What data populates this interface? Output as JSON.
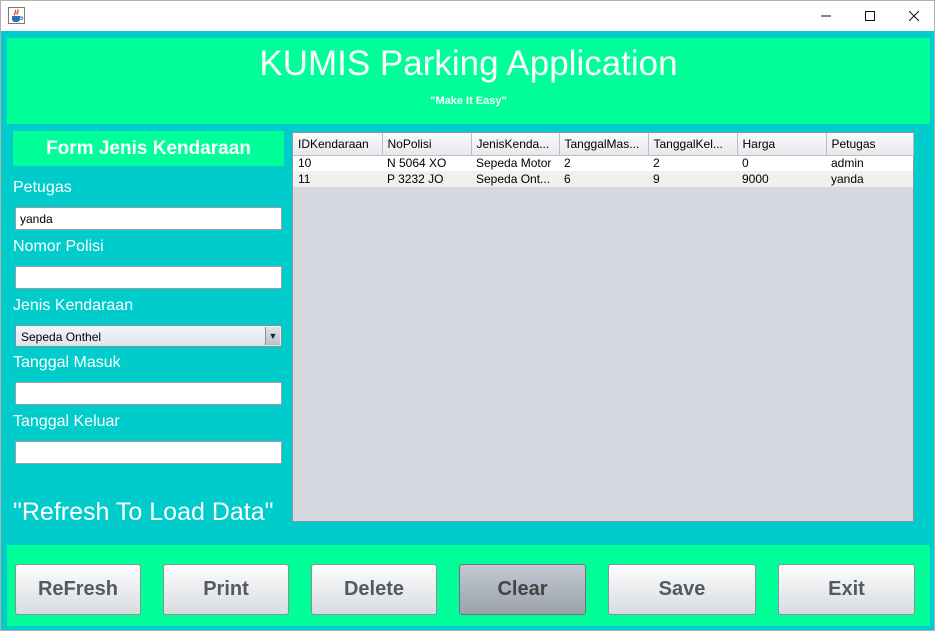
{
  "window": {
    "title": ""
  },
  "header": {
    "title": "KUMIS Parking Application",
    "subtitle": "\"Make It Easy\""
  },
  "form": {
    "title": "Form Jenis Kendaraan",
    "petugas_label": "Petugas",
    "petugas_value": "yanda",
    "nomor_polisi_label": "Nomor Polisi",
    "nomor_polisi_value": "",
    "jenis_kendaraan_label": "Jenis Kendaraan",
    "jenis_kendaraan_value": "Sepeda Onthel",
    "tanggal_masuk_label": "Tanggal Masuk",
    "tanggal_masuk_value": "",
    "tanggal_keluar_label": "Tanggal Keluar",
    "tanggal_keluar_value": "",
    "refresh_note": "\"Refresh To Load Data\""
  },
  "table": {
    "columns": [
      "IDKendaraan",
      "NoPolisi",
      "JenisKenda...",
      "TanggalMas...",
      "TanggalKel...",
      "Harga",
      "Petugas"
    ],
    "rows": [
      [
        "10",
        "N 5064 XO",
        "Sepeda Motor",
        "2",
        "2",
        "0",
        "admin"
      ],
      [
        "11",
        "P 3232 JO",
        "Sepeda Ont...",
        "6",
        "9",
        "9000",
        "yanda"
      ]
    ]
  },
  "buttons": {
    "refresh": "ReFresh",
    "print": "Print",
    "delete": "Delete",
    "clear": "Clear",
    "save": "Save",
    "exit": "Exit"
  },
  "colors": {
    "accent_green": "#00ff99",
    "panel_cyan": "#00cccc"
  },
  "icons": {
    "app": "java-cup-icon",
    "minimize": "minimize-icon",
    "maximize": "maximize-icon",
    "close": "close-icon",
    "dropdown": "chevron-down-icon"
  }
}
